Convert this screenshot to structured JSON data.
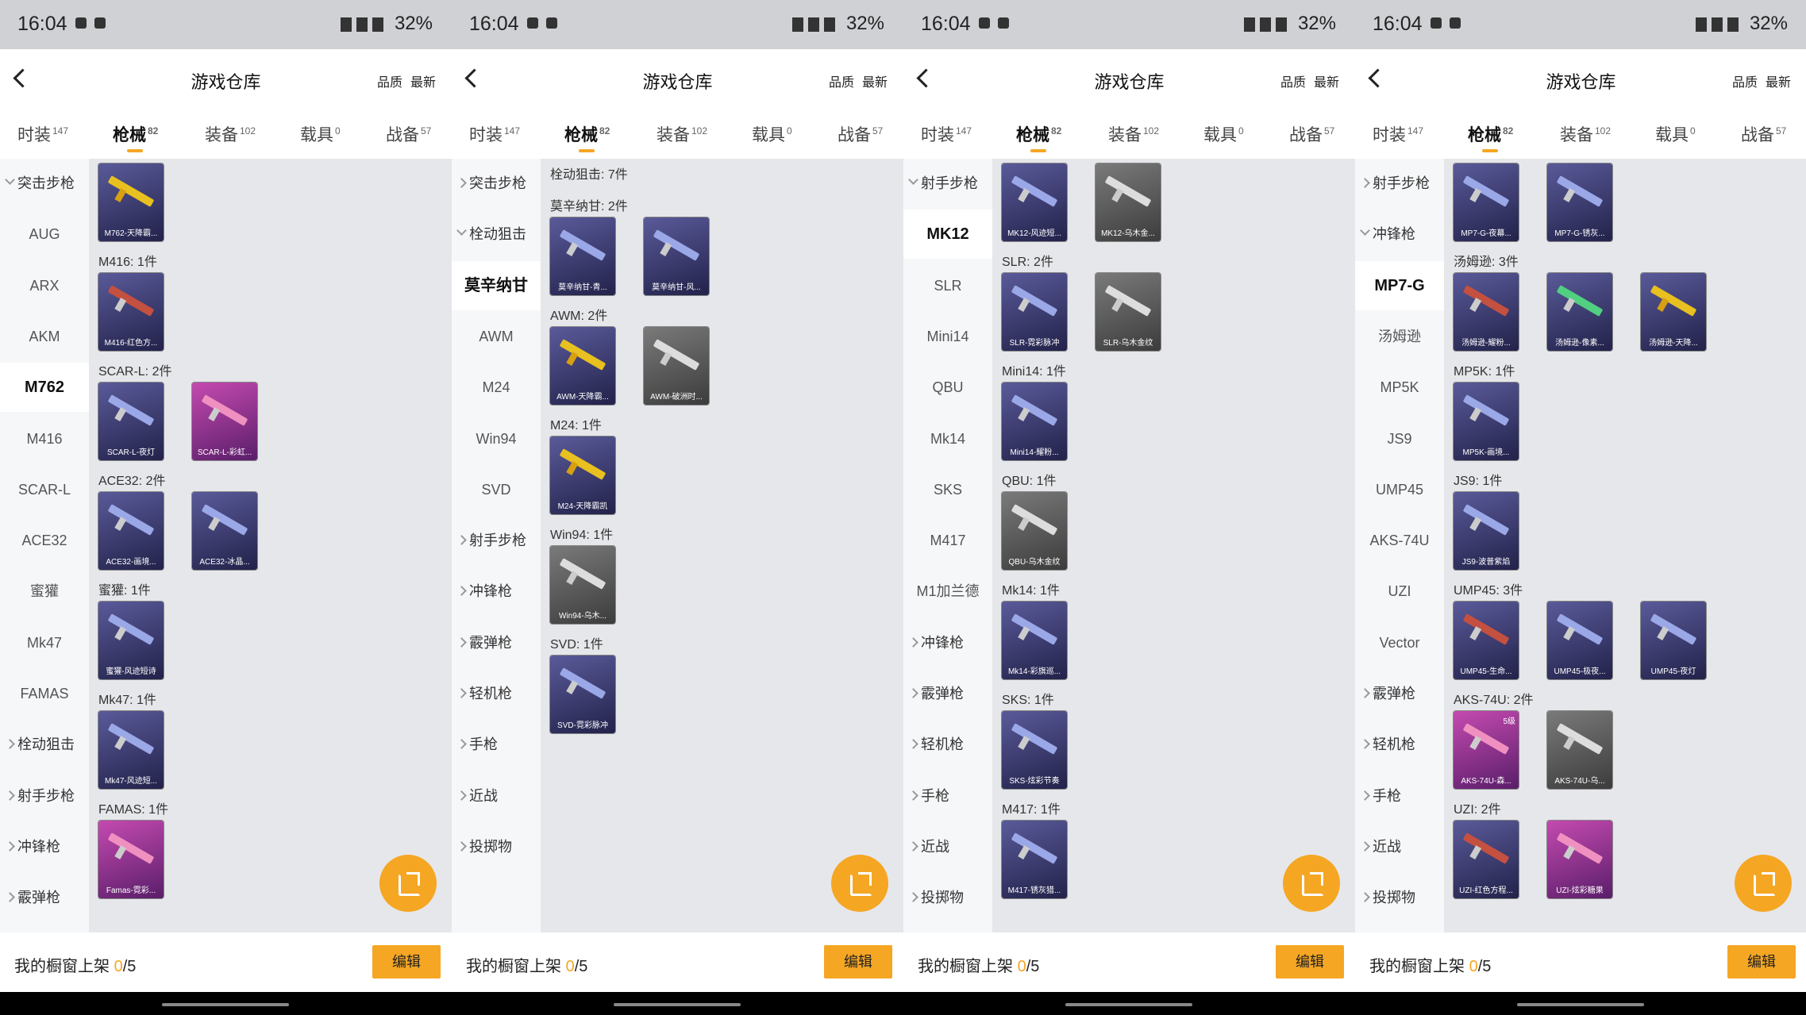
{
  "status": {
    "time": "16:04",
    "battery": "32%"
  },
  "header": {
    "title": "游戏仓库",
    "sort_quality": "品质",
    "sort_latest": "最新"
  },
  "tabs": [
    {
      "label": "时装",
      "count": "147"
    },
    {
      "label": "枪械",
      "count": "82"
    },
    {
      "label": "装备",
      "count": "102"
    },
    {
      "label": "载具",
      "count": "0"
    },
    {
      "label": "战备",
      "count": "57"
    }
  ],
  "bottom": {
    "label": "我的橱窗上架",
    "current": "0",
    "total": "/5",
    "edit": "编辑"
  },
  "screens": [
    {
      "sidebar": [
        {
          "label": "突击步枪",
          "type": "group",
          "open": true
        },
        {
          "label": "AUG"
        },
        {
          "label": "ARX"
        },
        {
          "label": "AKM"
        },
        {
          "label": "M762",
          "selected": true
        },
        {
          "label": "M416"
        },
        {
          "label": "SCAR-L"
        },
        {
          "label": "ACE32"
        },
        {
          "label": "蜜獾"
        },
        {
          "label": "Mk47"
        },
        {
          "label": "FAMAS"
        },
        {
          "label": "栓动狙击",
          "type": "group"
        },
        {
          "label": "射手步枪",
          "type": "group"
        },
        {
          "label": "冲锋枪",
          "type": "group"
        },
        {
          "label": "霰弹枪",
          "type": "group"
        }
      ],
      "sections": [
        {
          "header": "",
          "cards": [
            {
              "name": "M762-天降霸...",
              "color": "yellow"
            }
          ]
        },
        {
          "header": "M416: 1件",
          "cards": [
            {
              "name": "M416-红色方...",
              "color": "red"
            }
          ]
        },
        {
          "header": "SCAR-L: 2件",
          "cards": [
            {
              "name": "SCAR-L-夜灯",
              "color": "blue"
            },
            {
              "name": "SCAR-L-彩虹...",
              "color": "pink"
            }
          ]
        },
        {
          "header": "ACE32: 2件",
          "cards": [
            {
              "name": "ACE32-画境...",
              "color": "blue"
            },
            {
              "name": "ACE32-冰晶...",
              "color": "blue"
            }
          ]
        },
        {
          "header": "蜜獾: 1件",
          "cards": [
            {
              "name": "蜜獾-风迹短诗",
              "color": "blue"
            }
          ]
        },
        {
          "header": "Mk47: 1件",
          "cards": [
            {
              "name": "Mk47-风迹短...",
              "color": "blue"
            }
          ]
        },
        {
          "header": "FAMAS: 1件",
          "cards": [
            {
              "name": "Famas-霓彩...",
              "color": "pink"
            }
          ]
        }
      ]
    },
    {
      "sidebar": [
        {
          "label": "突击步枪",
          "type": "group"
        },
        {
          "label": "栓动狙击",
          "type": "group",
          "open": true
        },
        {
          "label": "莫辛纳甘",
          "selected": true
        },
        {
          "label": "AWM"
        },
        {
          "label": "M24"
        },
        {
          "label": "Win94"
        },
        {
          "label": "SVD"
        },
        {
          "label": "射手步枪",
          "type": "group"
        },
        {
          "label": "冲锋枪",
          "type": "group"
        },
        {
          "label": "霰弹枪",
          "type": "group"
        },
        {
          "label": "轻机枪",
          "type": "group"
        },
        {
          "label": "手枪",
          "type": "group"
        },
        {
          "label": "近战",
          "type": "group"
        },
        {
          "label": "投掷物",
          "type": "group"
        }
      ],
      "sections": [
        {
          "header": "栓动狙击: 7件",
          "cards": []
        },
        {
          "header": "莫辛纳甘: 2件",
          "cards": [
            {
              "name": "莫辛纳甘-青...",
              "color": "blue"
            },
            {
              "name": "莫辛纳甘-风...",
              "color": "blue"
            }
          ]
        },
        {
          "header": "AWM: 2件",
          "cards": [
            {
              "name": "AWM-天降霸...",
              "color": "yellow"
            },
            {
              "name": "AWM-破洲时...",
              "color": "grey"
            }
          ]
        },
        {
          "header": "M24: 1件",
          "cards": [
            {
              "name": "M24-天降霸凯",
              "color": "yellow"
            }
          ]
        },
        {
          "header": "Win94: 1件",
          "cards": [
            {
              "name": "Win94-乌木...",
              "color": "grey"
            }
          ]
        },
        {
          "header": "SVD: 1件",
          "cards": [
            {
              "name": "SVD-霓彩脉冲",
              "color": "blue"
            }
          ]
        }
      ]
    },
    {
      "sidebar": [
        {
          "label": "射手步枪",
          "type": "group",
          "open": true
        },
        {
          "label": "MK12",
          "selected": true
        },
        {
          "label": "SLR"
        },
        {
          "label": "Mini14"
        },
        {
          "label": "QBU"
        },
        {
          "label": "Mk14"
        },
        {
          "label": "SKS"
        },
        {
          "label": "M417"
        },
        {
          "label": "M1加兰德"
        },
        {
          "label": "冲锋枪",
          "type": "group"
        },
        {
          "label": "霰弹枪",
          "type": "group"
        },
        {
          "label": "轻机枪",
          "type": "group"
        },
        {
          "label": "手枪",
          "type": "group"
        },
        {
          "label": "近战",
          "type": "group"
        },
        {
          "label": "投掷物",
          "type": "group"
        }
      ],
      "sections": [
        {
          "header": "",
          "cards": [
            {
              "name": "MK12-风迹短...",
              "color": "blue"
            },
            {
              "name": "MK12-乌木金...",
              "color": "grey"
            }
          ]
        },
        {
          "header": "SLR: 2件",
          "cards": [
            {
              "name": "SLR-霓彩脉冲",
              "color": "blue"
            },
            {
              "name": "SLR-乌木金纹",
              "color": "grey"
            }
          ]
        },
        {
          "header": "Mini14: 1件",
          "cards": [
            {
              "name": "Mini14-耀粉...",
              "color": "blue"
            }
          ]
        },
        {
          "header": "QBU: 1件",
          "cards": [
            {
              "name": "QBU-乌木金纹",
              "color": "grey"
            }
          ]
        },
        {
          "header": "Mk14: 1件",
          "cards": [
            {
              "name": "Mk14-彩旗巡...",
              "color": "blue"
            }
          ]
        },
        {
          "header": "SKS: 1件",
          "cards": [
            {
              "name": "SKS-炫彩节奏",
              "color": "blue"
            }
          ]
        },
        {
          "header": "M417: 1件",
          "cards": [
            {
              "name": "M417-锈灰猎...",
              "color": "blue"
            }
          ]
        }
      ]
    },
    {
      "sidebar": [
        {
          "label": "射手步枪",
          "type": "group"
        },
        {
          "label": "冲锋枪",
          "type": "group",
          "open": true
        },
        {
          "label": "MP7-G",
          "selected": true
        },
        {
          "label": "汤姆逊"
        },
        {
          "label": "MP5K"
        },
        {
          "label": "JS9"
        },
        {
          "label": "UMP45"
        },
        {
          "label": "AKS-74U"
        },
        {
          "label": "UZI"
        },
        {
          "label": "Vector"
        },
        {
          "label": "霰弹枪",
          "type": "group"
        },
        {
          "label": "轻机枪",
          "type": "group"
        },
        {
          "label": "手枪",
          "type": "group"
        },
        {
          "label": "近战",
          "type": "group"
        },
        {
          "label": "投掷物",
          "type": "group"
        }
      ],
      "sections": [
        {
          "header": "",
          "cards": [
            {
              "name": "MP7-G-夜幕...",
              "color": "blue"
            },
            {
              "name": "MP7-G-锈灰...",
              "color": "blue"
            }
          ]
        },
        {
          "header": "汤姆逊: 3件",
          "cards": [
            {
              "name": "汤姆逊-耀粉...",
              "color": "red"
            },
            {
              "name": "汤姆逊-像素...",
              "color": "green"
            },
            {
              "name": "汤姆逊-天降...",
              "color": "yellow"
            }
          ]
        },
        {
          "header": "MP5K: 1件",
          "cards": [
            {
              "name": "MP5K-画境...",
              "color": "blue"
            }
          ]
        },
        {
          "header": "JS9: 1件",
          "cards": [
            {
              "name": "JS9-波普紫焰",
              "color": "blue"
            }
          ]
        },
        {
          "header": "UMP45: 3件",
          "cards": [
            {
              "name": "UMP45-生命...",
              "color": "red"
            },
            {
              "name": "UMP45-极夜...",
              "color": "blue"
            },
            {
              "name": "UMP45-夜灯",
              "color": "blue"
            }
          ]
        },
        {
          "header": "AKS-74U: 2件",
          "cards": [
            {
              "name": "AKS-74U-森...",
              "color": "pink",
              "badge": "5级"
            },
            {
              "name": "AKS-74U-乌...",
              "color": "grey"
            }
          ]
        },
        {
          "header": "UZI: 2件",
          "cards": [
            {
              "name": "UZI-红色方程...",
              "color": "red"
            },
            {
              "name": "UZI-炫彩糖果",
              "color": "pink"
            }
          ]
        }
      ]
    }
  ]
}
